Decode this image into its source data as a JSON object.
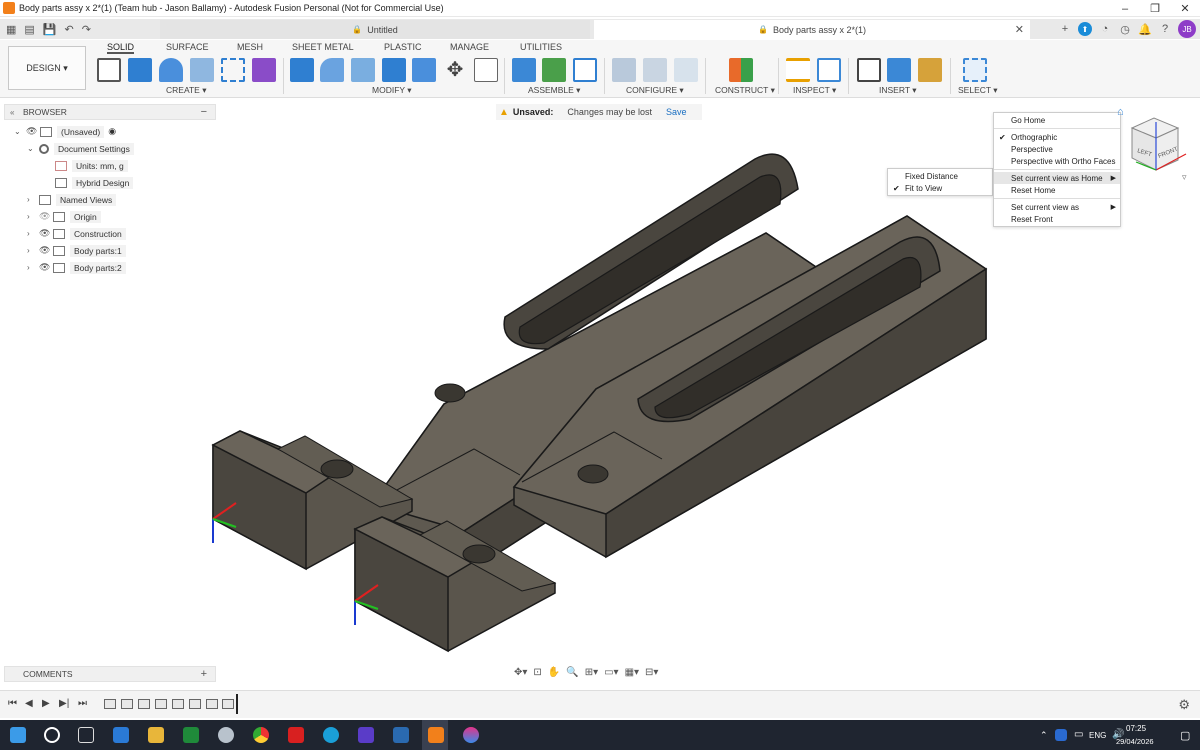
{
  "window": {
    "title": "Body parts assy x 2*(1) (Team hub - Jason Ballamy) - Autodesk Fusion Personal (Not for Commercial Use)",
    "controls": [
      "–",
      "❐",
      "✕"
    ]
  },
  "tabs": [
    {
      "label": "Untitled",
      "active": false
    },
    {
      "label": "Body parts assy x 2*(1)",
      "active": true
    }
  ],
  "user_initials": "JB",
  "workspace": {
    "label": "DESIGN ▾"
  },
  "ribbon_tabs": [
    "SOLID",
    "SURFACE",
    "MESH",
    "SHEET METAL",
    "PLASTIC",
    "MANAGE",
    "UTILITIES"
  ],
  "ribbon_groups": [
    "CREATE ▾",
    "MODIFY ▾",
    "ASSEMBLE ▾",
    "CONFIGURE ▾",
    "CONSTRUCT ▾",
    "INSPECT ▾",
    "INSERT ▾",
    "SELECT ▾"
  ],
  "browser": {
    "title": "BROWSER",
    "items": [
      {
        "label": "(Unsaved)"
      },
      {
        "label": "Document Settings"
      },
      {
        "label": "Units: mm, g"
      },
      {
        "label": "Hybrid Design"
      },
      {
        "label": "Named Views"
      },
      {
        "label": "Origin"
      },
      {
        "label": "Construction"
      },
      {
        "label": "Body parts:1"
      },
      {
        "label": "Body parts:2"
      }
    ]
  },
  "unsaved": {
    "label": "Unsaved:",
    "message": "Changes may be lost",
    "save": "Save"
  },
  "viewcube_menu": {
    "items": [
      "Go Home",
      "Orthographic",
      "Perspective",
      "Perspective with Ortho Faces",
      "Set current view as Home",
      "Reset Home",
      "Set current view as",
      "Reset Front"
    ],
    "checked": "Orthographic"
  },
  "home_submenu": {
    "items": [
      "Fixed Distance",
      "Fit to View"
    ],
    "checked": "Fit to View"
  },
  "viewcube": {
    "left": "LEFT",
    "front": "FRONT"
  },
  "comments": {
    "title": "COMMENTS"
  },
  "taskbar": {
    "lang": "ENG",
    "time": "07:25",
    "date": "29/04/2026"
  },
  "colors": {
    "body": "#5d5850",
    "body_light": "#7a7469",
    "accent": "#1a6fc2"
  }
}
